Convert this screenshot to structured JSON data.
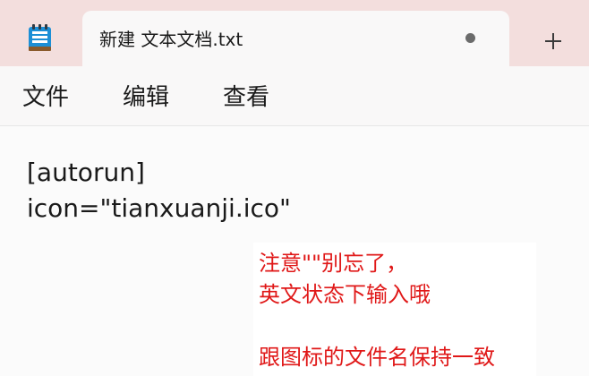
{
  "tab": {
    "title": "新建 文本文档.txt",
    "new_tab_symbol": "+",
    "app_icon": "notepad-icon",
    "modified_indicator_icon": "unsaved-dot-icon"
  },
  "menu": {
    "items": [
      "文件",
      "编辑",
      "查看"
    ]
  },
  "editor": {
    "lines": [
      "[autorun]",
      "icon=\"tianxuanji.ico\""
    ]
  },
  "annotation": {
    "lines": [
      "注意\"\"别忘了，",
      "英文状态下输入哦",
      "跟图标的文件名保持一致"
    ]
  },
  "colors": {
    "tabstrip_bg": "#f3dedd",
    "tab_bg": "#f9f8f8",
    "annotation_text": "#e01818"
  }
}
